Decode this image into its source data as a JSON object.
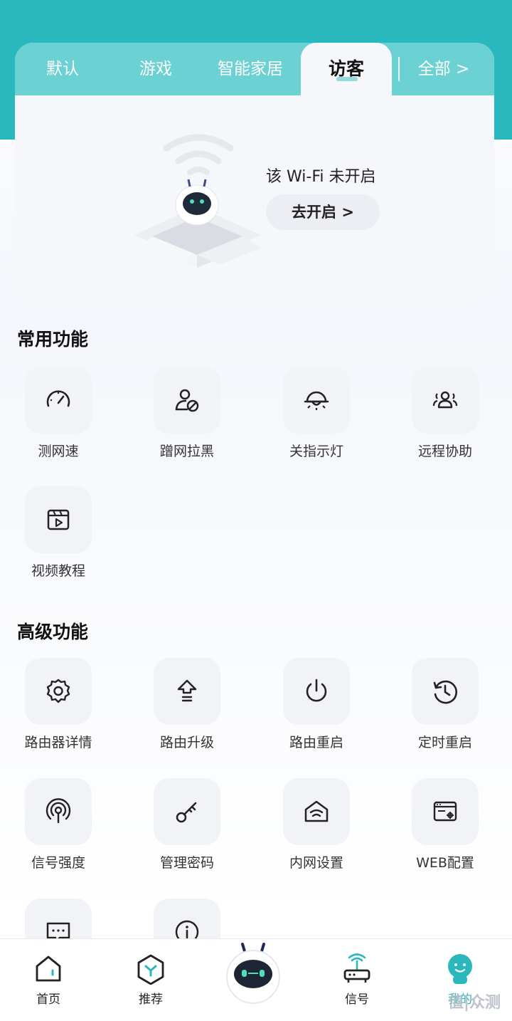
{
  "tabs": [
    "默认",
    "游戏",
    "智能家居"
  ],
  "active_tab": "访客",
  "all_tab": "全部 >",
  "guest_card": {
    "message": "该 Wi-Fi 未开启",
    "enable_button": "去开启 >"
  },
  "common_section": {
    "title": "常用功能",
    "items": [
      "测网速",
      "蹭网拉黑",
      "关指示灯",
      "远程协助",
      "视频教程"
    ]
  },
  "advanced_section": {
    "title": "高级功能",
    "items": [
      "路由器详情",
      "路由升级",
      "路由重启",
      "定时重启",
      "信号强度",
      "管理密码",
      "内网设置",
      "WEB配置",
      "",
      ""
    ]
  },
  "bottom_nav": {
    "home": "首页",
    "recommend": "推荐",
    "signal": "信号",
    "mine": "我的"
  },
  "watermark": "值|众测",
  "colors": {
    "teal": "#28b8bd",
    "tab_bar": "#6cd1d3",
    "icon_bg": "#f2f3f7"
  }
}
